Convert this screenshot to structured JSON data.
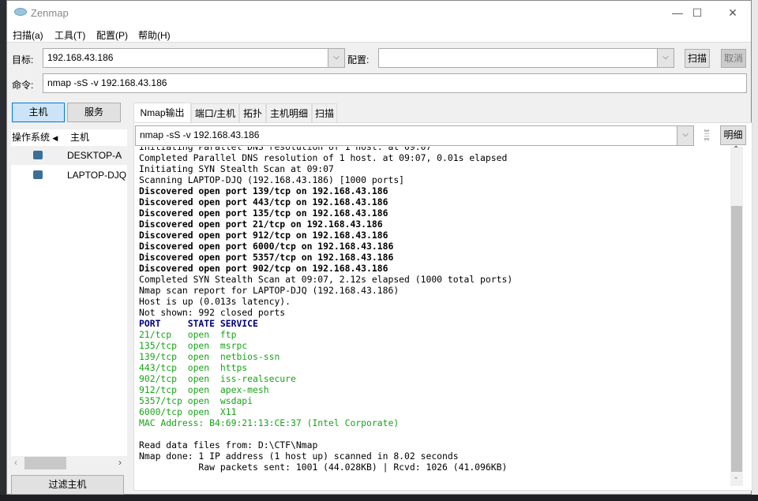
{
  "window": {
    "title": "Zenmap",
    "minimize": "—",
    "maximize": "☐",
    "close": "✕"
  },
  "menu": [
    "扫描(a)",
    "工具(T)",
    "配置(P)",
    "帮助(H)"
  ],
  "toolbar": {
    "target_label": "目标:",
    "target_value": "192.168.43.186",
    "profile_label": "配置:",
    "profile_value": "",
    "scan_button": "扫描",
    "cancel_button": "取消",
    "command_label": "命令:",
    "command_value": "nmap -sS -v 192.168.43.186"
  },
  "left": {
    "hosts_button": "主机",
    "services_button": "服务",
    "col_os": "操作系统",
    "col_host": "主机",
    "hosts": [
      "DESKTOP-A",
      "LAPTOP-DJQ"
    ],
    "filter_button": "过滤主机"
  },
  "tabs": [
    "Nmap输出",
    "端口/主机",
    "拓扑",
    "主机明细",
    "扫描"
  ],
  "output": {
    "selected_command": "nmap -sS -v 192.168.43.186",
    "details_button": "明细",
    "lines": [
      {
        "t": "Initiating Parallel DNS resolution of 1 host. at 09:07",
        "c": ""
      },
      {
        "t": "Completed Parallel DNS resolution of 1 host. at 09:07, 0.01s elapsed",
        "c": ""
      },
      {
        "t": "Initiating SYN Stealth Scan at 09:07",
        "c": ""
      },
      {
        "t": "Scanning LAPTOP-DJQ (192.168.43.186) [1000 ports]",
        "c": ""
      },
      {
        "t": "Discovered open port 139/tcp on 192.168.43.186",
        "c": "b"
      },
      {
        "t": "Discovered open port 443/tcp on 192.168.43.186",
        "c": "b"
      },
      {
        "t": "Discovered open port 135/tcp on 192.168.43.186",
        "c": "b"
      },
      {
        "t": "Discovered open port 21/tcp on 192.168.43.186",
        "c": "b"
      },
      {
        "t": "Discovered open port 912/tcp on 192.168.43.186",
        "c": "b"
      },
      {
        "t": "Discovered open port 6000/tcp on 192.168.43.186",
        "c": "b"
      },
      {
        "t": "Discovered open port 5357/tcp on 192.168.43.186",
        "c": "b"
      },
      {
        "t": "Discovered open port 902/tcp on 192.168.43.186",
        "c": "b"
      },
      {
        "t": "Completed SYN Stealth Scan at 09:07, 2.12s elapsed (1000 total ports)",
        "c": ""
      },
      {
        "t": "Nmap scan report for LAPTOP-DJQ (192.168.43.186)",
        "c": ""
      },
      {
        "t": "Host is up (0.013s latency).",
        "c": ""
      },
      {
        "t": "Not shown: 992 closed ports",
        "c": ""
      },
      {
        "t": "PORT     STATE SERVICE",
        "c": "navy"
      },
      {
        "t": "21/tcp   open  ftp",
        "c": "green"
      },
      {
        "t": "135/tcp  open  msrpc",
        "c": "green"
      },
      {
        "t": "139/tcp  open  netbios-ssn",
        "c": "green"
      },
      {
        "t": "443/tcp  open  https",
        "c": "green"
      },
      {
        "t": "902/tcp  open  iss-realsecure",
        "c": "green"
      },
      {
        "t": "912/tcp  open  apex-mesh",
        "c": "green"
      },
      {
        "t": "5357/tcp open  wsdapi",
        "c": "green"
      },
      {
        "t": "6000/tcp open  X11",
        "c": "green"
      },
      {
        "t": "MAC Address: B4:69:21:13:CE:37 (Intel Corporate)",
        "c": "green"
      },
      {
        "t": " ",
        "c": ""
      },
      {
        "t": "Read data files from: D:\\CTF\\Nmap",
        "c": ""
      },
      {
        "t": "Nmap done: 1 IP address (1 host up) scanned in 8.02 seconds",
        "c": ""
      },
      {
        "t": "           Raw packets sent: 1001 (44.028KB) | Rcvd: 1026 (41.096KB)",
        "c": ""
      }
    ]
  },
  "colors": {
    "open_port": "#1aa31a",
    "header": "#00007a",
    "active_button": "#cce4f7"
  }
}
